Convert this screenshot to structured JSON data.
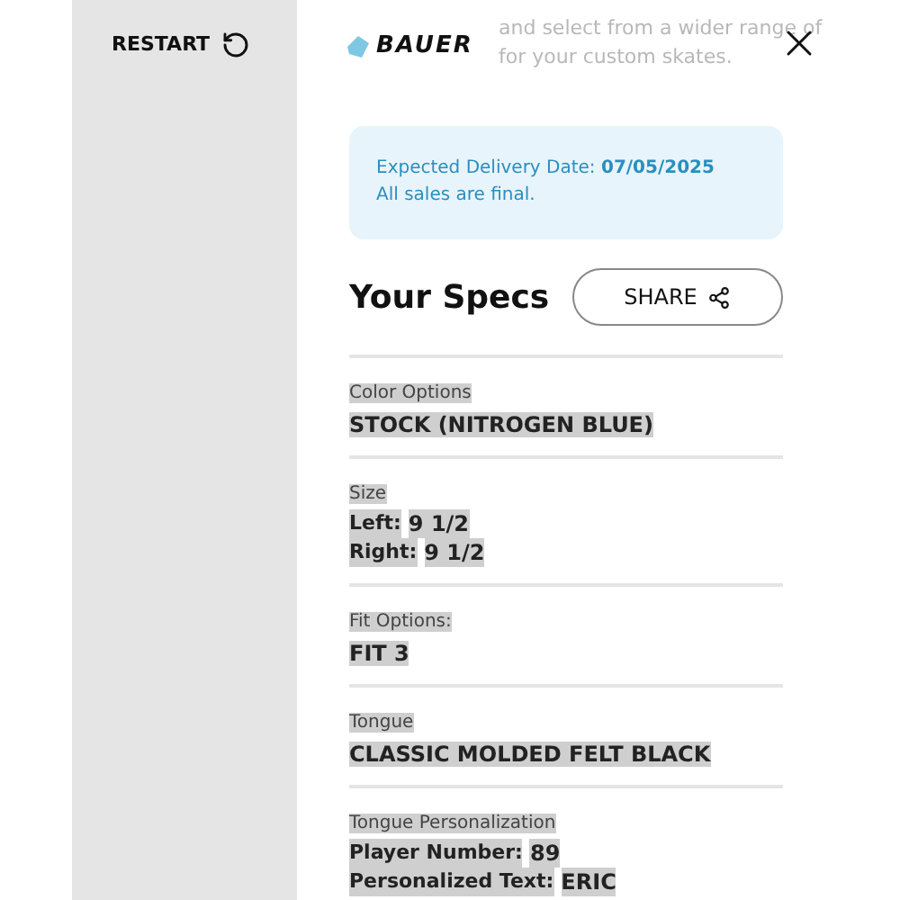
{
  "restart_button": {
    "label": "RESTART"
  },
  "background_text": [
    "and select from a wider range of",
    "for your custom skates."
  ],
  "logo": {
    "text": "BAUER"
  },
  "delivery_notice": {
    "label": "Expected Delivery Date:",
    "date": "07/05/2025",
    "note": "All sales are final."
  },
  "specs": {
    "title": "Your Specs",
    "share_button": {
      "label": "SHARE"
    },
    "sections": [
      {
        "label": "Color Options",
        "lines": [
          {
            "kind": "value",
            "value": "STOCK (NITROGEN BLUE)"
          }
        ]
      },
      {
        "label": "Size",
        "lines": [
          {
            "kind": "pair",
            "key": "Left:",
            "value": "9 1/2"
          },
          {
            "kind": "pair",
            "key": "Right:",
            "value": "9 1/2"
          }
        ]
      },
      {
        "label": "Fit Options:",
        "lines": [
          {
            "kind": "value",
            "value": "FIT 3"
          }
        ]
      },
      {
        "label": "Tongue",
        "lines": [
          {
            "kind": "value",
            "value": "CLASSIC MOLDED FELT BLACK"
          }
        ]
      },
      {
        "label": "Tongue Personalization",
        "lines": [
          {
            "kind": "pair",
            "key": "Player Number:",
            "value": "89"
          },
          {
            "kind": "pair",
            "key": "Personalized Text:",
            "value": "ERIC"
          }
        ]
      }
    ]
  }
}
